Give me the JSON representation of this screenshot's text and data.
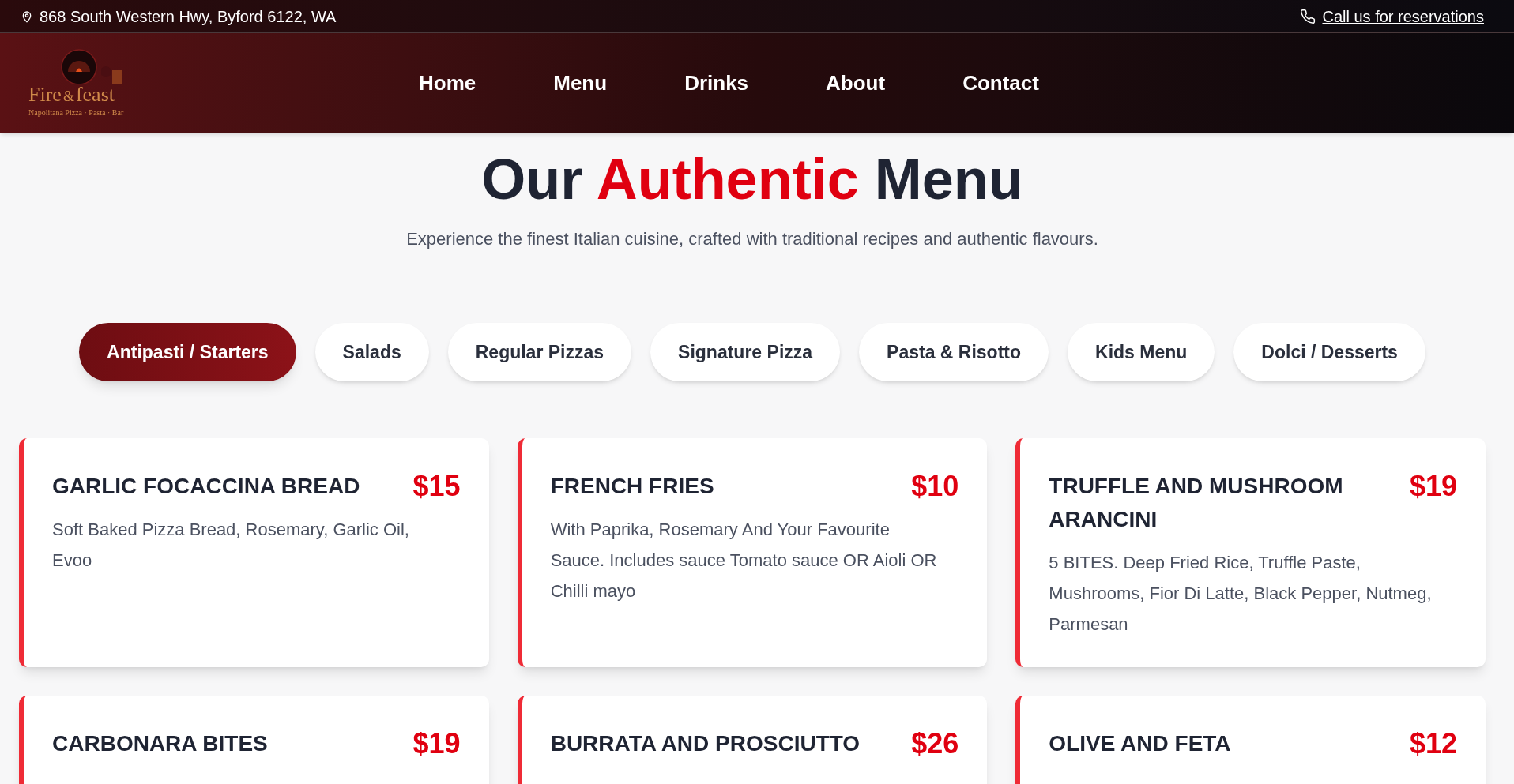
{
  "top_bar": {
    "address": "868 South Western Hwy, Byford 6122, WA",
    "reservation_link": "Call us for reservations"
  },
  "logo": {
    "name_part_1": "Fire",
    "ampersand": "&",
    "name_part_2": "feast",
    "tagline": "Napolitana Pizza · Pasta · Bar"
  },
  "nav": [
    {
      "label": "Home"
    },
    {
      "label": "Menu"
    },
    {
      "label": "Drinks"
    },
    {
      "label": "About"
    },
    {
      "label": "Contact"
    }
  ],
  "heading": {
    "before": "Our",
    "highlight": "Authentic",
    "after": "Menu"
  },
  "subtitle": "Experience the finest Italian cuisine, crafted with traditional recipes and authentic flavours.",
  "tabs": [
    {
      "label": "Antipasti / Starters",
      "selected": true
    },
    {
      "label": "Salads",
      "selected": false
    },
    {
      "label": "Regular Pizzas",
      "selected": false
    },
    {
      "label": "Signature Pizza",
      "selected": false
    },
    {
      "label": "Pasta & Risotto",
      "selected": false
    },
    {
      "label": "Kids Menu",
      "selected": false
    },
    {
      "label": "Dolci / Desserts",
      "selected": false
    }
  ],
  "items": [
    {
      "name": "GARLIC FOCACCINA BREAD",
      "price": "$15",
      "description": "Soft Baked Pizza Bread, Rosemary, Garlic Oil, Evoo"
    },
    {
      "name": "FRENCH FRIES",
      "price": "$10",
      "description": "With Paprika, Rosemary And Your Favourite Sauce. Includes sauce Tomato sauce OR Aioli OR Chilli mayo"
    },
    {
      "name": "TRUFFLE AND MUSHROOM ARANCINI",
      "price": "$19",
      "description": "5 BITES. Deep Fried Rice, Truffle Paste, Mushrooms, Fior Di Latte, Black Pepper, Nutmeg, Parmesan"
    },
    {
      "name": "CARBONARA BITES",
      "price": "$19"
    },
    {
      "name": "BURRATA AND PROSCIUTTO",
      "price": "$26"
    },
    {
      "name": "OLIVE AND FETA",
      "price": "$12"
    }
  ]
}
